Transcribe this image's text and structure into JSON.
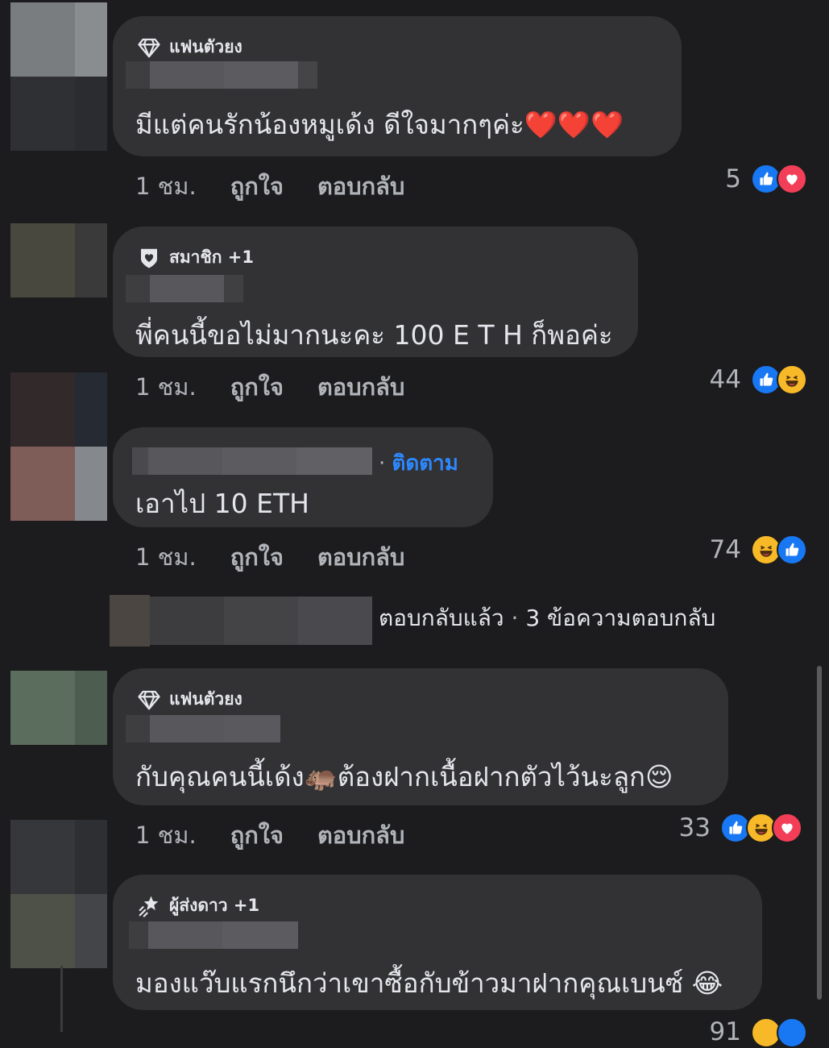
{
  "comments": [
    {
      "badge": "แฟนตัวยง",
      "badge_icon": "diamond-icon",
      "text": "มีแต่คนรักน้องหมูเด้ง ดีใจมากๆค่ะ",
      "emoji": "❤️❤️❤️",
      "time": "1 ชม.",
      "like_label": "ถูกใจ",
      "reply_label": "ตอบกลับ",
      "reaction_count": "5",
      "reactions": [
        "like",
        "love"
      ]
    },
    {
      "badge": "สมาชิก +1",
      "badge_icon": "member-shield-icon",
      "text": "พี่คนนี้ขอไม่มากนะคะ 100 E T H ก็พอค่ะ",
      "time": "1 ชม.",
      "like_label": "ถูกใจ",
      "reply_label": "ตอบกลับ",
      "reaction_count": "44",
      "reactions": [
        "like",
        "haha"
      ]
    },
    {
      "follow_label": "ติดตาม",
      "separator": "·",
      "text": "เอาไป 10 ETH",
      "time": "1 ชม.",
      "like_label": "ถูกใจ",
      "reply_label": "ตอบกลับ",
      "reaction_count": "74",
      "reactions": [
        "haha",
        "like"
      ],
      "replies_summary": {
        "replied": "ตอบกลับแล้ว",
        "separator": "·",
        "count": "3 ข้อความตอบกลับ"
      }
    },
    {
      "badge": "แฟนตัวยง",
      "badge_icon": "diamond-icon",
      "text_before": "กับคุณคนนี้เด้ง",
      "emoji_mid": "🦛",
      "text_after": "ต้องฝากเนื้อฝากตัวไว้นะลูก",
      "emoji": "😌",
      "time": "1 ชม.",
      "like_label": "ถูกใจ",
      "reply_label": "ตอบกลับ",
      "reaction_count": "33",
      "reactions": [
        "like",
        "haha",
        "love"
      ]
    },
    {
      "badge": "ผู้ส่งดาว +1",
      "badge_icon": "star-sender-icon",
      "text": "มองแว๊บแรกนึกว่าเขาซื้อกับข้าวมาฝากคุณเบนซ์",
      "emoji": "😂",
      "reaction_count": "91",
      "reactions": [
        "haha",
        "like"
      ]
    }
  ],
  "colors": {
    "background": "#1c1c1e",
    "bubble": "#323234",
    "like": "#1877f2",
    "love": "#f33e58",
    "haha": "#f7b928",
    "follow": "#2d88ff"
  }
}
